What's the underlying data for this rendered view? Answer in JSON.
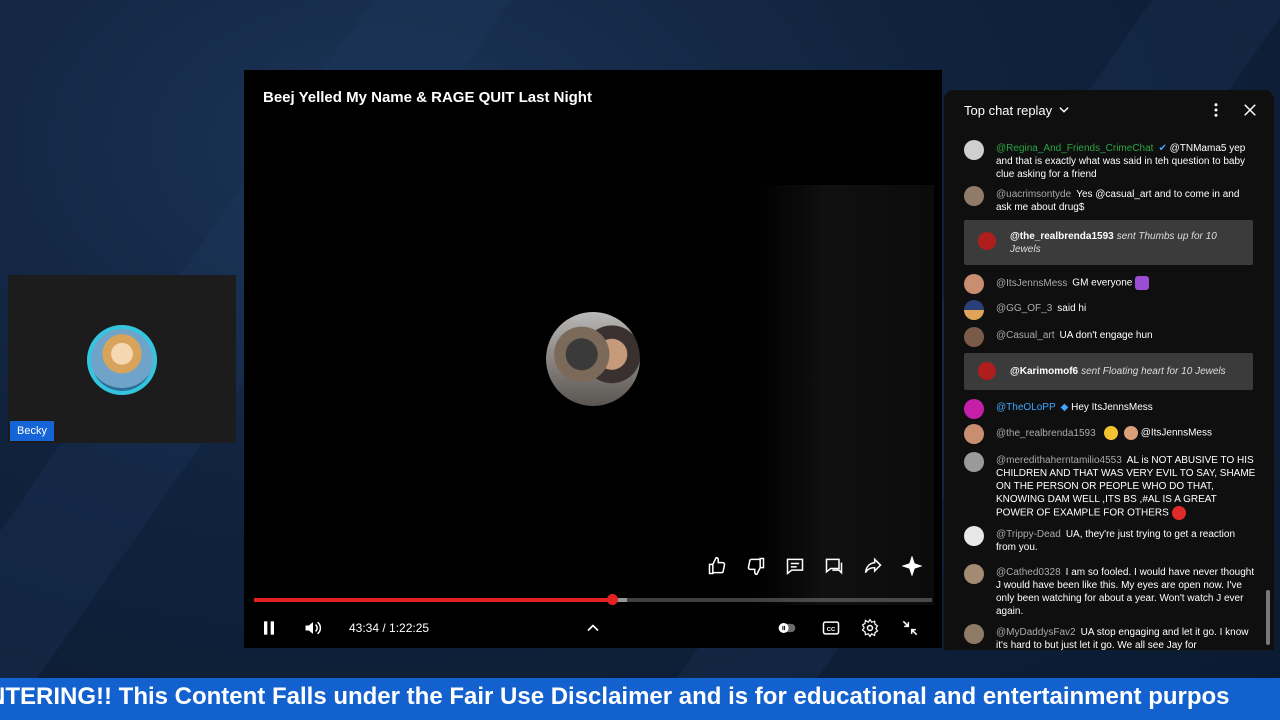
{
  "webcam": {
    "name": "Becky"
  },
  "video": {
    "title": "Beej Yelled My Name & RAGE QUIT Last Night",
    "current_time": "43:34",
    "separator": " / ",
    "duration": "1:22:25",
    "progress_fraction": 0.5286,
    "actions": [
      "like-icon",
      "dislike-icon",
      "comment-icon",
      "chat-icon",
      "share-icon",
      "sparkle-icon"
    ]
  },
  "chat": {
    "title": "Top chat replay",
    "messages": [
      {
        "author": "@Regina_And_Friends_CrimeChat",
        "text": "@TNMama5 yep and that is exactly what was said in teh question to baby clue asking for a friend"
      },
      {
        "author": "@uacrimsontyde",
        "text": "Yes @casual_art and to come in and ask me about drug$"
      },
      {
        "author": "@the_realbrenda1593",
        "text": "sent Thumbs up for 10 Jewels"
      },
      {
        "author": "@ItsJennsMess",
        "text": "GM everyone"
      },
      {
        "author": "@GG_OF_3",
        "text": "said hi"
      },
      {
        "author": "@Casual_art",
        "text": "UA don't engage hun"
      },
      {
        "author": "@Karimomof6",
        "text": "sent Floating heart for 10 Jewels"
      },
      {
        "author": "@TheOLoPP",
        "text": "Hey ItsJennsMess"
      },
      {
        "author": "@the_realbrenda1593",
        "text": "@ItsJennsMess"
      },
      {
        "author": "@meredithaherntamilio4553",
        "text": "AL is NOT ABUSIVE TO HIS CHILDREN AND THAT WAS VERY EVIL TO SAY, SHAME ON THE PERSON OR PEOPLE WHO DO THAT, KNOWING DAM WELL ,ITS BS ,#AL IS A GREAT POWER OF EXAMPLE FOR OTHERS"
      },
      {
        "author": "@Trippy-Dead",
        "text": "UA, they're just trying to get a reaction from you."
      },
      {
        "author": "@Cathed0328",
        "text": "I am so fooled. I would have never thought J would have been like this. My eyes are open now. I've only been watching for about a year. Won't watch J ever again."
      },
      {
        "author": "@MyDaddysFav2",
        "text": "UA stop engaging and let it go. I know it's hard to but just let it go. We all see Jay for"
      }
    ]
  },
  "ticker": {
    "text": "NTERING!! This Content Falls under the Fair Use Disclaimer and is for educational and entertainment purpos"
  },
  "colors": {
    "accent_red": "#e52222",
    "ticker_blue": "#1261cf",
    "chat_bg": "#0f0f0f"
  }
}
